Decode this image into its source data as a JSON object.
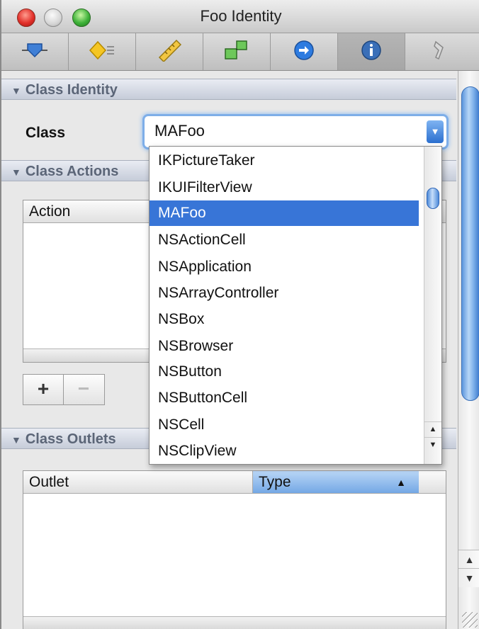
{
  "window": {
    "title": "Foo Identity"
  },
  "toolbar": {
    "tabs": [
      {
        "icon": "attributes-icon",
        "selected": false
      },
      {
        "icon": "effects-icon",
        "selected": false
      },
      {
        "icon": "size-ruler-icon",
        "selected": false
      },
      {
        "icon": "connections-icon",
        "selected": false
      },
      {
        "icon": "bindings-arrow-icon",
        "selected": false
      },
      {
        "icon": "info-identity-icon",
        "selected": true
      },
      {
        "icon": "applescript-icon",
        "selected": false
      }
    ]
  },
  "class_identity": {
    "header": "Class Identity",
    "class_label": "Class",
    "class_value": "MAFoo"
  },
  "class_actions": {
    "header": "Class Actions",
    "columns": [
      "Action"
    ],
    "add_label": "+",
    "remove_label": "−"
  },
  "class_outlets": {
    "header": "Class Outlets",
    "columns": [
      "Outlet",
      "Type"
    ],
    "sort_indicator": "▲"
  },
  "dropdown": {
    "items": [
      "IKPictureTaker",
      "IKUIFilterView",
      "MAFoo",
      "NSActionCell",
      "NSApplication",
      "NSArrayController",
      "NSBox",
      "NSBrowser",
      "NSButton",
      "NSButtonCell",
      "NSCell",
      "NSClipView"
    ],
    "selected": "MAFoo"
  },
  "colors": {
    "selection": "#3875d7",
    "focus_ring": "#7eaee8",
    "section_header_text": "#5b6577"
  }
}
